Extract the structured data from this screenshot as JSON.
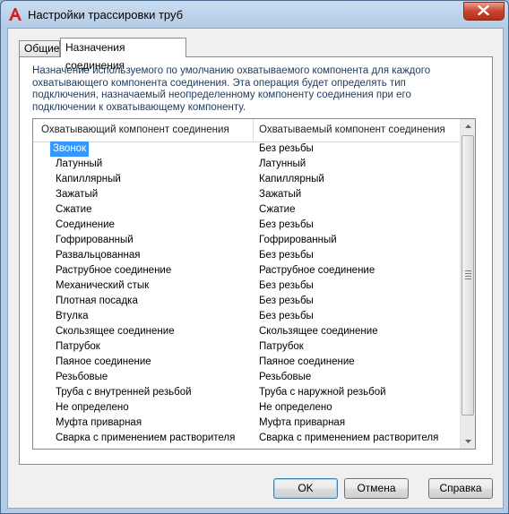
{
  "window": {
    "title": "Настройки трассировки труб",
    "app_icon": "autocad-a-icon",
    "close_icon": "close-icon"
  },
  "tabs": [
    {
      "label": "Общие",
      "active": false
    },
    {
      "label": "Назначения соединения",
      "active": true
    }
  ],
  "description": "Назначение используемого по умолчанию охватываемого компонента для каждого охватывающего компонента соединения. Эта операция будет определять тип подключения, назначаемый неопределенному компоненту соединения при его подключении к охватывающему компоненту.",
  "grid": {
    "headers": [
      "Охватывающий компонент соединения",
      "Охватываемый компонент соединения"
    ],
    "rows": [
      {
        "female": "Звонок",
        "male": "Без резьбы"
      },
      {
        "female": "Латунный",
        "male": "Латунный"
      },
      {
        "female": "Капиллярный",
        "male": "Капиллярный"
      },
      {
        "female": "Зажатый",
        "male": "Зажатый"
      },
      {
        "female": "Сжатие",
        "male": "Сжатие"
      },
      {
        "female": "Соединение",
        "male": "Без резьбы"
      },
      {
        "female": "Гофрированный",
        "male": "Гофрированный"
      },
      {
        "female": "Развальцованная",
        "male": "Без резьбы"
      },
      {
        "female": "Раструбное соединение",
        "male": "Раструбное соединение"
      },
      {
        "female": "Механический стык",
        "male": "Без резьбы"
      },
      {
        "female": "Плотная посадка",
        "male": "Без резьбы"
      },
      {
        "female": "Втулка",
        "male": "Без резьбы"
      },
      {
        "female": "Скользящее соединение",
        "male": "Скользящее соединение"
      },
      {
        "female": "Патрубок",
        "male": "Патрубок"
      },
      {
        "female": "Паяное соединение",
        "male": "Паяное соединение"
      },
      {
        "female": "Резьбовые",
        "male": "Резьбовые"
      },
      {
        "female": "Труба с внутренней резьбой",
        "male": "Труба с наружной резьбой"
      },
      {
        "female": "Не определено",
        "male": "Не определено"
      },
      {
        "female": "Муфта приварная",
        "male": "Муфта приварная"
      },
      {
        "female": "Сварка с применением растворителя",
        "male": "Сварка с применением растворителя"
      }
    ],
    "selected_row": 0
  },
  "buttons": {
    "ok": "OK",
    "cancel": "Отмена",
    "help": "Справка"
  },
  "colors": {
    "selection": "#3399ff",
    "description_text": "#1e3a5f",
    "close_button": "#c9452e"
  }
}
